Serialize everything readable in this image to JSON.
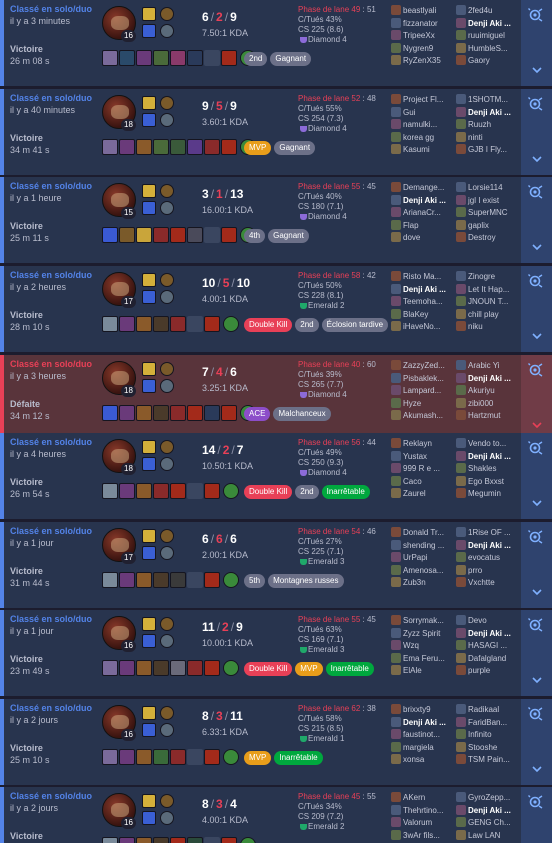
{
  "matches": [
    {
      "result_type": "win",
      "queue": "Classé en solo/duo",
      "ago": "il y a 3 minutes",
      "result": "Victoire",
      "duration": "26 m 08 s",
      "level": "16",
      "k": "6",
      "d": "2",
      "a": "9",
      "ratio": "7.50:1 KDA",
      "lane_label": "Phase de lane 49",
      "lane_score": ": 51",
      "ckill": "C/Tués 43%",
      "cs": "CS 225 (8.6)",
      "rank": "Diamond 4",
      "rank_color": "diamond",
      "tags": [
        {
          "t": "2nd",
          "c": "grey"
        },
        {
          "t": "Gagnant",
          "c": "grey"
        }
      ],
      "items": [
        "#7a6a9a",
        "#2a4a6a",
        "#6a3a7a",
        "#4a6a3a",
        "#8a3a6a",
        "#2a3a5a",
        "empty",
        "#a32a1a",
        "#3a8a3a"
      ],
      "team1": [
        "beastlyali",
        "fizzanator",
        "TripeeXx",
        "Nygren9",
        "RyZenX35"
      ],
      "team2": [
        "2fed4u",
        "Denji Aki ...",
        "ruuimiguel",
        "HumbleS...",
        "Gaory"
      ]
    },
    {
      "result_type": "win",
      "queue": "Classé en solo/duo",
      "ago": "il y a 40 minutes",
      "result": "Victoire",
      "duration": "34 m 41 s",
      "level": "18",
      "k": "9",
      "d": "5",
      "a": "9",
      "ratio": "3.60:1 KDA",
      "lane_label": "Phase de lane 52",
      "lane_score": ": 48",
      "ckill": "C/Tués 55%",
      "cs": "CS 254 (7.3)",
      "rank": "Diamond 4",
      "rank_color": "diamond",
      "tags": [
        {
          "t": "MVP",
          "c": "mvp"
        },
        {
          "t": "Gagnant",
          "c": "grey"
        }
      ],
      "items": [
        "#7a6a9a",
        "#6a3a7a",
        "#8a5a2a",
        "#4a6a3a",
        "#3a5a3a",
        "#5a3a8a",
        "#8a2a2a",
        "#a32a1a",
        "#3a8a3a"
      ],
      "team1": [
        "Project Fl...",
        "Gui",
        "namulki...",
        "korea gg",
        "Kasumi"
      ],
      "team2": [
        "1SHOTM...",
        "Denji Aki ...",
        "Ruuzh",
        "ninti",
        "GJB I Fly..."
      ]
    },
    {
      "result_type": "win",
      "queue": "Classé en solo/duo",
      "ago": "il y a 1 heure",
      "result": "Victoire",
      "duration": "25 m 11 s",
      "level": "15",
      "k": "3",
      "d": "1",
      "a": "13",
      "ratio": "16.00:1 KDA",
      "lane_label": "Phase de lane 55",
      "lane_score": ": 45",
      "ckill": "C/Tués 40%",
      "cs": "CS 180 (7.1)",
      "rank": "Diamond 4",
      "rank_color": "diamond",
      "tags": [
        {
          "t": "4th",
          "c": "grey"
        },
        {
          "t": "Gagnant",
          "c": "grey"
        }
      ],
      "items": [
        "#3a5ad4",
        "#7a5a2a",
        "#c9a53a",
        "#8a2a2a",
        "#a32a1a",
        "#4a4a5a",
        "empty",
        "#a32a1a",
        "#3a8a3a"
      ],
      "team1": [
        "Demange...",
        "Denji Aki ...",
        "ArianaCr...",
        "Flap",
        "dove"
      ],
      "team2": [
        "Lorsie114",
        "jgl I exist",
        "SuperMNC",
        "gaplix",
        "Destroy"
      ]
    },
    {
      "result_type": "win",
      "queue": "Classé en solo/duo",
      "ago": "il y a 2 heures",
      "result": "Victoire",
      "duration": "28 m 10 s",
      "level": "17",
      "k": "10",
      "d": "5",
      "a": "10",
      "ratio": "4.00:1 KDA",
      "lane_label": "Phase de lane 58",
      "lane_score": ": 42",
      "ckill": "C/Tués 50%",
      "cs": "CS 228 (8.1)",
      "rank": "Emerald 2",
      "rank_color": "emerald",
      "tags": [
        {
          "t": "Double Kill",
          "c": "red"
        },
        {
          "t": "2nd",
          "c": "grey"
        },
        {
          "t": "Éclosion tardive",
          "c": "grey"
        }
      ],
      "items": [
        "#7a8a9a",
        "#6a3a7a",
        "#8a5a2a",
        "#4a3a2a",
        "#8a2a2a",
        "empty",
        "#a32a1a",
        "#3a8a3a"
      ],
      "team1": [
        "Risto Ma...",
        "Denji Aki ...",
        "Teemoha...",
        "BlaKey",
        "iHaveNo..."
      ],
      "team2": [
        "Zinogre",
        "Let It Hap...",
        "JNOUN T...",
        "chill play",
        "niku"
      ]
    },
    {
      "result_type": "loss",
      "queue": "Classé en solo/duo",
      "ago": "il y a 3 heures",
      "result": "Défaite",
      "duration": "34 m 12 s",
      "level": "18",
      "k": "7",
      "d": "4",
      "a": "6",
      "ratio": "3.25:1 KDA",
      "lane_label": "Phase de lane 40",
      "lane_score": ": 60",
      "ckill": "C/Tués 39%",
      "cs": "CS 265 (7.7)",
      "rank": "Diamond 4",
      "rank_color": "diamond",
      "tags": [
        {
          "t": "ACE",
          "c": "ace"
        },
        {
          "t": "Malchanceux",
          "c": "grey"
        }
      ],
      "items": [
        "#3a5ad4",
        "#6a3a7a",
        "#8a5a2a",
        "#4a3a2a",
        "#8a2a2a",
        "#a32a1a",
        "#2a3a5a",
        "#a32a1a",
        "#3a8a3a"
      ],
      "team1": [
        "ZazzyZed...",
        "Pisbaklek...",
        "Lampard...",
        "Hyze",
        "Akumash..."
      ],
      "team2": [
        "Arabic Yi",
        "Denji Aki ...",
        "Akuriyu",
        "zibi000",
        "Hartzmut"
      ]
    },
    {
      "result_type": "win",
      "queue": "Classé en solo/duo",
      "ago": "il y a 4 heures",
      "result": "Victoire",
      "duration": "26 m 54 s",
      "level": "18",
      "k": "14",
      "d": "2",
      "a": "7",
      "ratio": "10.50:1 KDA",
      "lane_label": "Phase de lane 56",
      "lane_score": ": 44",
      "ckill": "C/Tués 49%",
      "cs": "CS 250 (9.3)",
      "rank": "Diamond 4",
      "rank_color": "diamond",
      "tags": [
        {
          "t": "Double Kill",
          "c": "red"
        },
        {
          "t": "2nd",
          "c": "grey"
        },
        {
          "t": "Inarrêtable",
          "c": "green"
        }
      ],
      "items": [
        "#7a8a9a",
        "#6a3a7a",
        "#8a5a2a",
        "#8a2a2a",
        "#a32a1a",
        "empty",
        "#a32a1a",
        "#3a8a3a"
      ],
      "team1": [
        "Reklayn",
        "Yustax",
        "999 R e ...",
        "Caco",
        "Zaurel"
      ],
      "team2": [
        "Vendo to...",
        "Denji Aki ...",
        "Shakles",
        "Ego Bxxst",
        "Megumin"
      ]
    },
    {
      "result_type": "win",
      "queue": "Classé en solo/duo",
      "ago": "il y a 1 jour",
      "result": "Victoire",
      "duration": "31 m 44 s",
      "level": "17",
      "k": "6",
      "d": "6",
      "a": "6",
      "ratio": "2.00:1 KDA",
      "lane_label": "Phase de lane 54",
      "lane_score": ": 46",
      "ckill": "C/Tués 27%",
      "cs": "CS 225 (7.1)",
      "rank": "Emerald 3",
      "rank_color": "emerald",
      "tags": [
        {
          "t": "5th",
          "c": "grey"
        },
        {
          "t": "Montagnes russes",
          "c": "grey"
        }
      ],
      "items": [
        "#7a8a9a",
        "#6a3a7a",
        "#8a5a2a",
        "#4a3a2a",
        "#3a3a3a",
        "empty",
        "#a32a1a",
        "#3a8a3a"
      ],
      "team1": [
        "Donald Tr...",
        "shending ...",
        "UrPapi",
        "Amenosa...",
        "Zub3n"
      ],
      "team2": [
        "1Rise OF ...",
        "Denji Aki ...",
        "evocatus",
        "prro",
        "Vxchtte"
      ]
    },
    {
      "result_type": "win",
      "queue": "Classé en solo/duo",
      "ago": "il y a 1 jour",
      "result": "Victoire",
      "duration": "23 m 49 s",
      "level": "16",
      "k": "11",
      "d": "2",
      "a": "9",
      "ratio": "10.00:1 KDA",
      "lane_label": "Phase de lane 55",
      "lane_score": ": 45",
      "ckill": "C/Tués 63%",
      "cs": "CS 169 (7.1)",
      "rank": "Emerald 3",
      "rank_color": "emerald",
      "tags": [
        {
          "t": "Double Kill",
          "c": "red"
        },
        {
          "t": "MVP",
          "c": "mvp"
        },
        {
          "t": "Inarrêtable",
          "c": "green"
        }
      ],
      "items": [
        "#7a6a9a",
        "#6a3a7a",
        "#8a5a2a",
        "#4a3a2a",
        "#6a6a7a",
        "#8a2a2a",
        "#a32a1a",
        "#3a8a3a"
      ],
      "team1": [
        "Sorrymak...",
        "Zyzz Spirit",
        "Wzq",
        "Ema Feru...",
        "ElAle"
      ],
      "team2": [
        "Devo",
        "Denji Aki ...",
        "HASAGI ...",
        "Dafalgland",
        "purple"
      ]
    },
    {
      "result_type": "win",
      "queue": "Classé en solo/duo",
      "ago": "il y a 2 jours",
      "result": "Victoire",
      "duration": "25 m 10 s",
      "level": "16",
      "k": "8",
      "d": "3",
      "a": "11",
      "ratio": "6.33:1 KDA",
      "lane_label": "Phase de lane 62",
      "lane_score": ": 38",
      "ckill": "C/Tués 58%",
      "cs": "CS 215 (8.5)",
      "rank": "Emerald 1",
      "rank_color": "emerald",
      "tags": [
        {
          "t": "MVP",
          "c": "mvp"
        },
        {
          "t": "Inarrêtable",
          "c": "green"
        }
      ],
      "items": [
        "#7a6a9a",
        "#6a3a7a",
        "#8a5a2a",
        "#3a6a3a",
        "#8a2a2a",
        "empty",
        "#a32a1a",
        "#3a8a3a"
      ],
      "team1": [
        "brixxty9",
        "Denji Aki ...",
        "faustinot...",
        "margiela",
        "xonsa"
      ],
      "team2": [
        "Radikaal",
        "FaridBan...",
        "Infinito",
        "Stooshe",
        "TSM Pain..."
      ]
    },
    {
      "result_type": "win",
      "queue": "Classé en solo/duo",
      "ago": "il y a 2 jours",
      "result": "Victoire",
      "duration": "",
      "level": "16",
      "k": "8",
      "d": "3",
      "a": "4",
      "ratio": "4.00:1 KDA",
      "lane_label": "Phase de lane 45",
      "lane_score": ": 55",
      "ckill": "C/Tués 34%",
      "cs": "CS 209 (7.2)",
      "rank": "Emerald 2",
      "rank_color": "emerald",
      "tags": [],
      "items": [
        "#7a8a9a",
        "#6a3a7a",
        "#8a5a2a",
        "#4a3a2a",
        "#a32a1a",
        "#2a4a3a",
        "empty",
        "#a32a1a",
        "#3a8a3a"
      ],
      "team1": [
        "AKern",
        "Thehrtino...",
        "Valorum",
        "3wAr fils..."
      ],
      "team2": [
        "GyroZepp...",
        "Denji Aki ...",
        "GENG Ch...",
        "Law LAN"
      ]
    }
  ]
}
